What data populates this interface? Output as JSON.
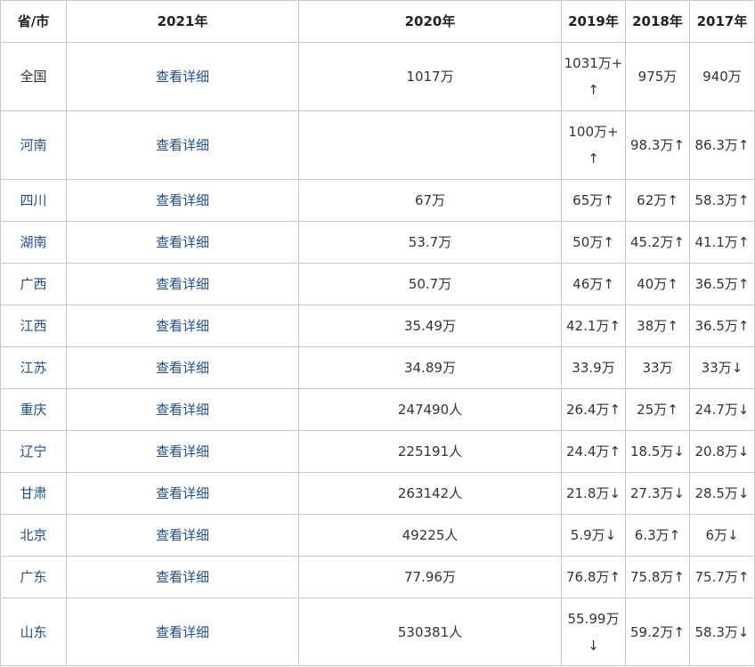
{
  "table": {
    "headers": [
      "省/市",
      "2021年",
      "2020年",
      "2019年",
      "2018年",
      "2017年"
    ],
    "rows": [
      {
        "region": "全国",
        "y2021": "查看详细",
        "y2020": "1017万",
        "y2019": "1031万+↑",
        "y2018": "975万",
        "y2017": "940万",
        "region_link": false
      },
      {
        "region": "河南",
        "y2021": "查看详细",
        "y2020": "",
        "y2019": "100万+↑",
        "y2018": "98.3万↑",
        "y2017": "86.3万↑",
        "region_link": true
      },
      {
        "region": "四川",
        "y2021": "查看详细",
        "y2020": "67万",
        "y2019": "65万↑",
        "y2018": "62万↑",
        "y2017": "58.3万↑",
        "region_link": true
      },
      {
        "region": "湖南",
        "y2021": "查看详细",
        "y2020": "53.7万",
        "y2019": "50万↑",
        "y2018": "45.2万↑",
        "y2017": "41.1万↑",
        "region_link": true
      },
      {
        "region": "广西",
        "y2021": "查看详细",
        "y2020": "50.7万",
        "y2019": "46万↑",
        "y2018": "40万↑",
        "y2017": "36.5万↑",
        "region_link": true
      },
      {
        "region": "江西",
        "y2021": "查看详细",
        "y2020": "35.49万",
        "y2019": "42.1万↑",
        "y2018": "38万↑",
        "y2017": "36.5万↑",
        "region_link": true
      },
      {
        "region": "江苏",
        "y2021": "查看详细",
        "y2020": "34.89万",
        "y2019": "33.9万",
        "y2018": "33万",
        "y2017": "33万↓",
        "region_link": true
      },
      {
        "region": "重庆",
        "y2021": "查看详细",
        "y2020": "247490人",
        "y2019": "26.4万↑",
        "y2018": "25万↑",
        "y2017": "24.7万↓",
        "region_link": true
      },
      {
        "region": "辽宁",
        "y2021": "查看详细",
        "y2020": "225191人",
        "y2019": "24.4万↑",
        "y2018": "18.5万↓",
        "y2017": "20.8万↓",
        "region_link": true
      },
      {
        "region": "甘肃",
        "y2021": "查看详细",
        "y2020": "263142人",
        "y2019": "21.8万↓",
        "y2018": "27.3万↓",
        "y2017": "28.5万↓",
        "region_link": true
      },
      {
        "region": "北京",
        "y2021": "查看详细",
        "y2020": "49225人",
        "y2019": "5.9万↓",
        "y2018": "6.3万↑",
        "y2017": "6万↓",
        "region_link": true
      },
      {
        "region": "广东",
        "y2021": "查看详细",
        "y2020": "77.96万",
        "y2019": "76.8万↑",
        "y2018": "75.8万↑",
        "y2017": "75.7万↑",
        "region_link": true
      },
      {
        "region": "山东",
        "y2021": "查看详细",
        "y2020": "530381人",
        "y2019": "55.99万↓",
        "y2018": "59.2万↑",
        "y2017": "58.3万↓",
        "region_link": true
      }
    ]
  },
  "colors": {
    "link": "#1f4e8c",
    "text": "#333333",
    "border": "#c8c8c8"
  }
}
